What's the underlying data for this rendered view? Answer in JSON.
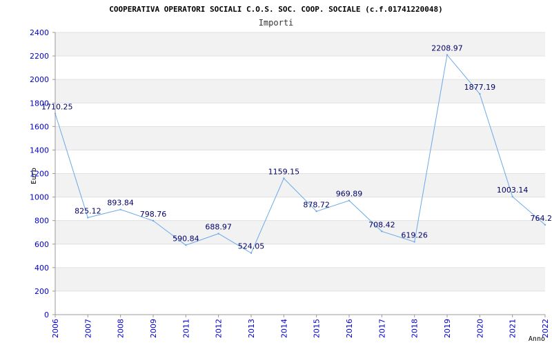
{
  "chart_data": {
    "type": "line",
    "title": "COOPERATIVA OPERATORI SOCIALI C.O.S. SOC. COOP. SOCIALE (c.f.01741220048)",
    "subtitle": "Importi",
    "xlabel": "Anno",
    "ylabel": "Euro",
    "ylim": [
      0,
      2400
    ],
    "y_ticks": [
      "0",
      "200",
      "400",
      "600",
      "800",
      "1000",
      "1200",
      "1400",
      "1600",
      "1800",
      "2000",
      "2200",
      "2400"
    ],
    "categories": [
      "2006",
      "2007",
      "2008",
      "2009",
      "2011",
      "2012",
      "2013",
      "2014",
      "2015",
      "2016",
      "2017",
      "2018",
      "2019",
      "2020",
      "2021",
      "2022"
    ],
    "values": [
      1710.25,
      825.12,
      893.84,
      798.76,
      590.84,
      688.97,
      524.05,
      1159.15,
      878.72,
      969.89,
      708.42,
      619.26,
      2208.97,
      1877.19,
      1003.14,
      764.2
    ],
    "value_labels": [
      "1710.25",
      "825.12",
      "893.84",
      "798.76",
      "590.84",
      "688.97",
      "524.05",
      "1159.15",
      "878.72",
      "969.89",
      "708.42",
      "619.26",
      "2208.97",
      "1877.19",
      "1003.14",
      "764.2"
    ],
    "grid": true,
    "colors": {
      "line": "#6aa8e8",
      "band": "#f2f2f2",
      "grid": "#e0e0e0",
      "axis": "#999999",
      "tick_text": "#0000cc",
      "value_text": "#000066"
    }
  }
}
